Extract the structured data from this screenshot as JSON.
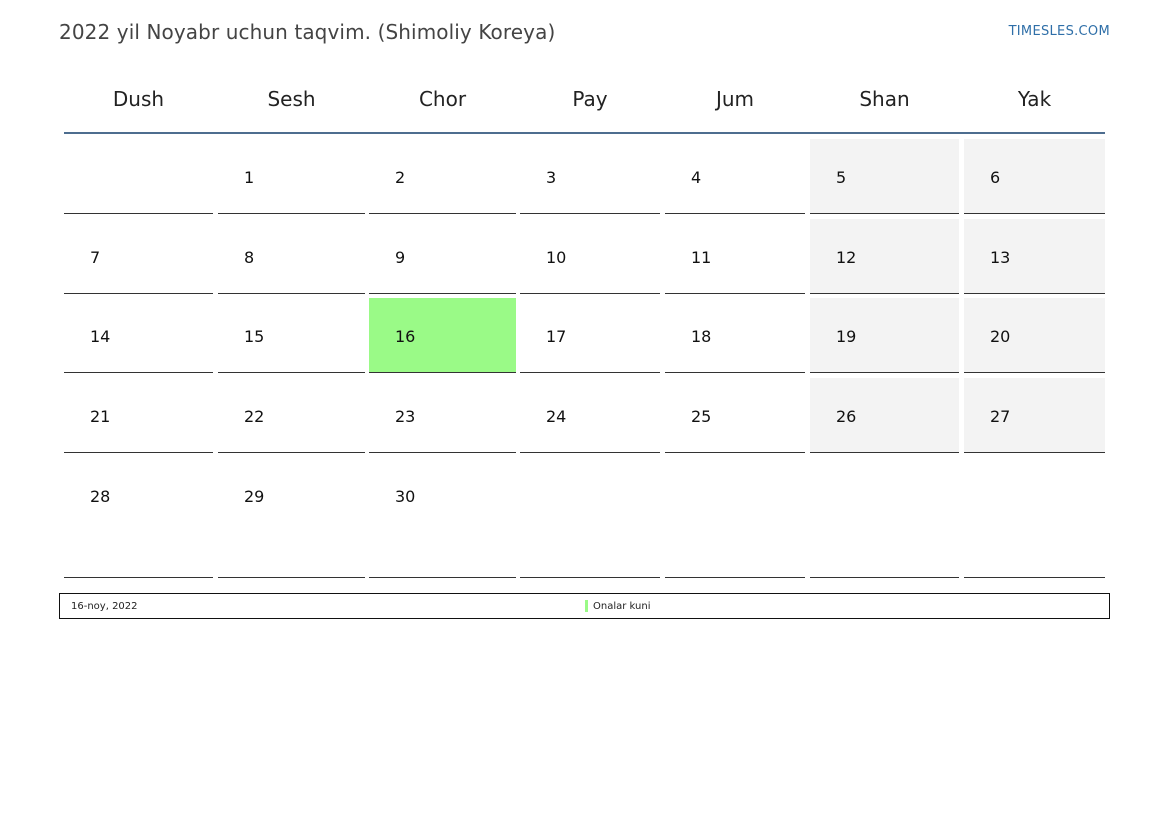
{
  "header": {
    "title": "2022 yil Noyabr uchun taqvim. (Shimoliy Koreya)",
    "brand": "TIMESLES.COM"
  },
  "weekdays": [
    "Dush",
    "Sesh",
    "Chor",
    "Pay",
    "Jum",
    "Shan",
    "Yak"
  ],
  "weeks": [
    [
      "",
      "1",
      "2",
      "3",
      "4",
      "5",
      "6"
    ],
    [
      "7",
      "8",
      "9",
      "10",
      "11",
      "12",
      "13"
    ],
    [
      "14",
      "15",
      "16",
      "17",
      "18",
      "19",
      "20"
    ],
    [
      "21",
      "22",
      "23",
      "24",
      "25",
      "26",
      "27"
    ],
    [
      "28",
      "29",
      "30",
      "",
      "",
      "",
      ""
    ]
  ],
  "highlight": {
    "day": "16",
    "color": "#9afa87"
  },
  "weekend_color": "#f3f3f3",
  "legend": {
    "date": "16-noy, 2022",
    "name": "Onalar kuni",
    "color": "#9afa87"
  }
}
